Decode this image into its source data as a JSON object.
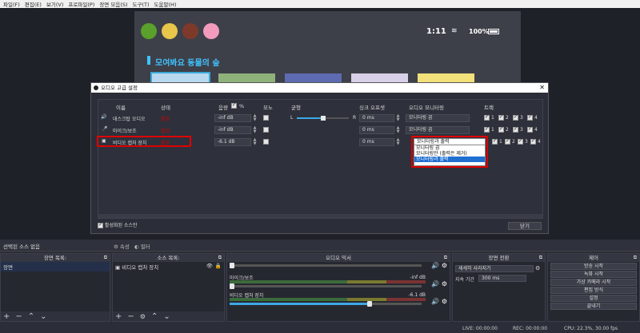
{
  "menu": [
    "파일(F)",
    "편집(E)",
    "보기(V)",
    "프로파일(P)",
    "장면 모음(S)",
    "도구(T)",
    "도움말(H)"
  ],
  "preview": {
    "clock": "1:11",
    "wifi_icon": "wifi-icon",
    "battery": "100%",
    "heading": "모여봐요 동물의 숲"
  },
  "dialog": {
    "title": "오디오 고급 설정",
    "close_icon": "close-icon",
    "headers": {
      "name": "이름",
      "status": "상태",
      "volume": "음량",
      "percent": "%",
      "mono": "모노",
      "balance": "균형",
      "sync_offset": "싱크 오프셋",
      "monitoring": "오디오 모니터링",
      "tracks": "트랙"
    },
    "rows": [
      {
        "name": "데스크탑 오디오",
        "status": "활성",
        "volume": "-inf dB",
        "balance_left": "L",
        "balance_right": "R",
        "sync": "0 ms",
        "monitoring": "모니터링 끔",
        "tracks": [
          "1",
          "2",
          "3",
          "4"
        ]
      },
      {
        "name": "마이크/보조",
        "status": "활성",
        "volume": "-inf dB",
        "sync": "0 ms",
        "monitoring": "모니터링 끔",
        "tracks": [
          "1",
          "2",
          "3",
          "4"
        ]
      },
      {
        "name": "비디오 캡처 장치",
        "status": "활성",
        "volume": "-6.1 dB",
        "sync": "0 ms",
        "monitoring": "모니터링과 출력",
        "tracks": [
          "1",
          "2",
          "3",
          "4"
        ]
      }
    ],
    "monitoring_options": [
      "모니터링 끔",
      "모니터링만 (출력은 제거)",
      "모니터링과 출력"
    ],
    "advanced_checkbox": "활성화된 소스만",
    "close_button": "닫기"
  },
  "sourcebar": {
    "label": "선택된 소스 없음",
    "props": "속성",
    "filters": "필터"
  },
  "scenes": {
    "title": "장면 목록:",
    "items": [
      "장면"
    ]
  },
  "sources": {
    "title": "소스 목록:",
    "items": [
      "비디오 캡처 장치"
    ]
  },
  "mixer": {
    "title": "오디오 믹서",
    "channels": [
      {
        "name": "마이크/보조",
        "db": "-inf dB",
        "level": 0
      },
      {
        "name": "비디오 캡처 장치",
        "db": "-6.1 dB",
        "level": 0.72
      }
    ]
  },
  "transitions": {
    "title": "장면 전환",
    "type": "세세히 사라지기",
    "duration_label": "지속 기간",
    "duration_value": "300 ms"
  },
  "controls": {
    "title": "제어",
    "buttons": [
      "방송 시작",
      "녹화 시작",
      "가상 카메라 시작",
      "편집 방식",
      "설정",
      "끝내기"
    ]
  },
  "status": {
    "live": "LIVE: 00:00:00",
    "rec": "REC: 00:00:00",
    "cpu": "CPU: 22.3%, 30.00 fps"
  }
}
